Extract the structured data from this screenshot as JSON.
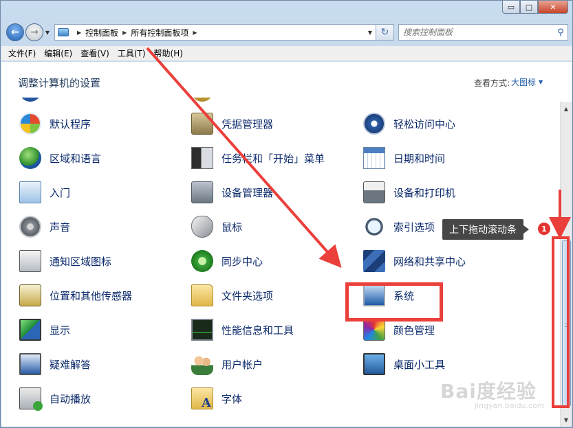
{
  "window": {
    "caption_buttons": {
      "minimize": "▭",
      "maximize": "□",
      "close": "✕"
    }
  },
  "address": {
    "breadcrumbs": [
      "控制面板",
      "所有控制面板项"
    ],
    "search_placeholder": "搜索控制面板"
  },
  "menu": [
    "文件(F)",
    "编辑(E)",
    "查看(V)",
    "工具(T)",
    "帮助(H)"
  ],
  "header": {
    "title": "调整计算机的设置",
    "view_by_label": "查看方式:",
    "view_by_value": "大图标"
  },
  "items": {
    "col1": [
      {
        "label": "默认程序",
        "icon": "default-programs-icon"
      },
      {
        "label": "区域和语言",
        "icon": "region-language-icon"
      },
      {
        "label": "入门",
        "icon": "getting-started-icon"
      },
      {
        "label": "声音",
        "icon": "sound-icon"
      },
      {
        "label": "通知区域图标",
        "icon": "notification-icons-icon"
      },
      {
        "label": "位置和其他传感器",
        "icon": "location-sensors-icon"
      },
      {
        "label": "显示",
        "icon": "display-icon"
      },
      {
        "label": "疑难解答",
        "icon": "troubleshooting-icon"
      },
      {
        "label": "自动播放",
        "icon": "autoplay-icon"
      }
    ],
    "col2": [
      {
        "label": "凭据管理器",
        "icon": "credential-manager-icon"
      },
      {
        "label": "任务栏和「开始」菜单",
        "icon": "taskbar-start-menu-icon"
      },
      {
        "label": "设备管理器",
        "icon": "device-manager-icon"
      },
      {
        "label": "鼠标",
        "icon": "mouse-icon"
      },
      {
        "label": "同步中心",
        "icon": "sync-center-icon"
      },
      {
        "label": "文件夹选项",
        "icon": "folder-options-icon"
      },
      {
        "label": "性能信息和工具",
        "icon": "performance-icon"
      },
      {
        "label": "用户帐户",
        "icon": "user-accounts-icon"
      },
      {
        "label": "字体",
        "icon": "fonts-icon"
      }
    ],
    "col3": [
      {
        "label": "轻松访问中心",
        "icon": "ease-of-access-icon"
      },
      {
        "label": "日期和时间",
        "icon": "date-time-icon"
      },
      {
        "label": "设备和打印机",
        "icon": "devices-printers-icon"
      },
      {
        "label": "索引选项",
        "icon": "indexing-options-icon"
      },
      {
        "label": "网络和共享中心",
        "icon": "network-sharing-icon"
      },
      {
        "label": "系统",
        "icon": "system-icon"
      },
      {
        "label": "颜色管理",
        "icon": "color-management-icon"
      },
      {
        "label": "桌面小工具",
        "icon": "desktop-gadgets-icon"
      }
    ]
  },
  "annotation": {
    "tooltip": "上下拖动滚动条",
    "badge": "1",
    "highlight_color": "#ea3f3a"
  },
  "watermark": {
    "main": "Bai度经验",
    "sub": "jingyan.baidu.com"
  }
}
